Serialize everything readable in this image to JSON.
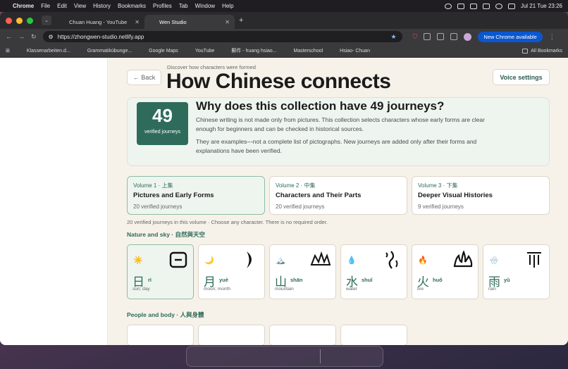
{
  "menubar": {
    "app": "Chrome",
    "items": [
      "File",
      "Edit",
      "View",
      "History",
      "Bookmarks",
      "Profiles",
      "Tab",
      "Window",
      "Help"
    ],
    "clock": "Jul 21 Tue  23:26"
  },
  "tabs": [
    {
      "title": "Chuan Huang - YouTube",
      "color": "#ff0000"
    },
    {
      "title": "Wen Studio",
      "color": "#9aa0a6"
    }
  ],
  "toolbar": {
    "url": "https://zhongwen-studio.netlify.app",
    "update_label": "New Chrome available"
  },
  "bookmarks": [
    {
      "label": "Klassenarbeiten.d...",
      "color": "#4a8fd8"
    },
    {
      "label": "Grammatikübunge...",
      "color": "#d0d0d0"
    },
    {
      "label": "Google Maps",
      "color": "#34a853"
    },
    {
      "label": "YouTube",
      "color": "#ff0000"
    },
    {
      "label": "郵件 - huang hsiao...",
      "color": "#4a8fd8"
    },
    {
      "label": "Masterschool",
      "color": "#bbbbbb"
    },
    {
      "label": "Hsiao- Chuan",
      "color": "#bbbbbb"
    }
  ],
  "bookmarks_all": "All Bookmarks",
  "page": {
    "back_label": "← Back",
    "eyebrow": "Discover how characters were formed",
    "title": "How Chinese connects",
    "voice_label": "Voice settings",
    "why": {
      "count": "49",
      "count_label": "verified journeys",
      "title": "Why does this collection have 49 journeys?",
      "p1": "Chinese writing is not made only from pictures. This collection selects characters whose early forms are clear enough for beginners and can be checked in historical sources.",
      "p2": "They are examples—not a complete list of pictographs. New journeys are added only after their forms and explanations have been verified."
    },
    "volumes": [
      {
        "kicker": "Volume 1 · 上集",
        "title": "Pictures and Early Forms",
        "count": "20 verified journeys"
      },
      {
        "kicker": "Volume 2 · 中集",
        "title": "Characters and Their Parts",
        "count": "20 verified journeys"
      },
      {
        "kicker": "Volume 3 · 下集",
        "title": "Deeper Visual Histories",
        "count": "9 verified journeys"
      }
    ],
    "hint": "20 verified journeys in this volume · Choose any character. There is no required order.",
    "section1": "Nature and sky · 自然與天空",
    "section2": "People and body · 人與身體",
    "cards": [
      {
        "emoji": "☀️",
        "char": "日",
        "pinyin": "rì",
        "meaning": "sun; day",
        "glyph": "sun"
      },
      {
        "emoji": "🌙",
        "char": "月",
        "pinyin": "yuè",
        "meaning": "moon; month",
        "glyph": "moon"
      },
      {
        "emoji": "🏔️",
        "char": "山",
        "pinyin": "shān",
        "meaning": "mountain",
        "glyph": "mountain"
      },
      {
        "emoji": "💧",
        "char": "水",
        "pinyin": "shuǐ",
        "meaning": "water",
        "glyph": "water"
      },
      {
        "emoji": "🔥",
        "char": "火",
        "pinyin": "huǒ",
        "meaning": "fire",
        "glyph": "fire"
      },
      {
        "emoji": "🌧️",
        "char": "雨",
        "pinyin": "yǔ",
        "meaning": "rain",
        "glyph": "rain"
      }
    ]
  },
  "dock": [
    {
      "name": "finder-icon",
      "color": "#3d8be8"
    },
    {
      "name": "mail-icon",
      "color": "#4aa3f2"
    },
    {
      "name": "notion-icon",
      "color": "#f2f2f2"
    },
    {
      "name": "chrome-icon",
      "color": "#e8b82a"
    },
    {
      "name": "word-icon",
      "color": "#2b5bb8"
    },
    {
      "name": "app-icon",
      "color": "#6b7de0"
    },
    {
      "name": "whatsapp-icon",
      "color": "#25d366"
    },
    {
      "name": "utility-icon",
      "color": "#8a8f98"
    },
    {
      "name": "quicktime-icon",
      "color": "#2f86d6"
    },
    {
      "name": "trash-icon",
      "color": "#9aa0a6"
    }
  ]
}
